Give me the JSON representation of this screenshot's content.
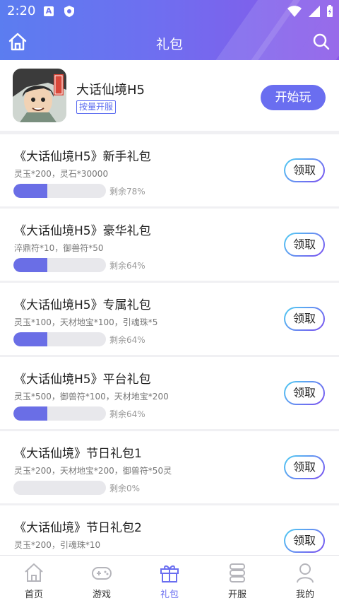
{
  "status": {
    "time": "2:20"
  },
  "header": {
    "title": "礼包"
  },
  "game": {
    "name": "大话仙境H5",
    "tag": "按量开服",
    "play_label": "开始玩"
  },
  "gifts": [
    {
      "name": "《大话仙境H5》新手礼包",
      "desc": "灵玉*200，灵石*30000",
      "remain_pct": 78,
      "remain_text": "剩余78%",
      "claim": "领取"
    },
    {
      "name": "《大话仙境H5》豪华礼包",
      "desc": "淬鼎符*10，御兽符*50",
      "remain_pct": 64,
      "remain_text": "剩余64%",
      "claim": "领取"
    },
    {
      "name": "《大话仙境H5》专属礼包",
      "desc": "灵玉*100，天材地宝*100，引魂珠*5",
      "remain_pct": 64,
      "remain_text": "剩余64%",
      "claim": "领取"
    },
    {
      "name": "《大话仙境H5》平台礼包",
      "desc": "灵玉*500，御兽符*100，天材地宝*200",
      "remain_pct": 64,
      "remain_text": "剩余64%",
      "claim": "领取"
    },
    {
      "name": "《大话仙境》节日礼包1",
      "desc": "灵玉*200，天材地宝*200，御兽符*50灵",
      "remain_pct": 0,
      "remain_text": "剩余0%",
      "claim": "领取"
    },
    {
      "name": "《大话仙境》节日礼包2",
      "desc": "灵玉*200，引魂珠*10",
      "remain_pct": null,
      "remain_text": "",
      "claim": "领取"
    }
  ],
  "tabs": [
    {
      "label": "首页",
      "icon": "home-icon"
    },
    {
      "label": "游戏",
      "icon": "gamepad-icon"
    },
    {
      "label": "礼包",
      "icon": "gift-icon",
      "active": true
    },
    {
      "label": "开服",
      "icon": "server-icon"
    },
    {
      "label": "我的",
      "icon": "profile-icon"
    }
  ],
  "colors": {
    "accent": "#6a6ef0",
    "header_start": "#5b7df0",
    "header_end": "#8a56e8"
  }
}
